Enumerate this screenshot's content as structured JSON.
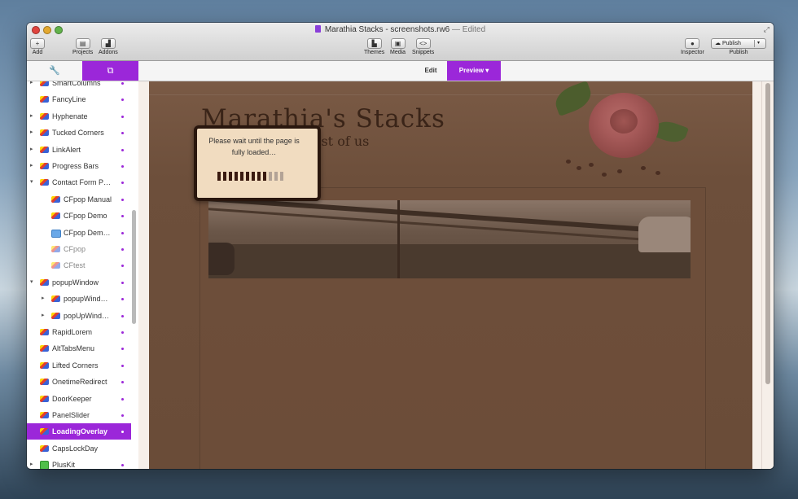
{
  "window": {
    "title": "Marathia Stacks - screenshots.rw6",
    "title_status": "— Edited"
  },
  "toolbar": {
    "add_label": "Add",
    "projects_label": "Projects",
    "addons_label": "Addons",
    "themes_label": "Themes",
    "media_label": "Media",
    "snippets_label": "Snippets",
    "inspector_label": "Inspector",
    "publish_button": "Publish",
    "publish_label": "Publish"
  },
  "modes": {
    "edit": "Edit",
    "preview": "Preview ▾"
  },
  "sidebar": {
    "items": [
      {
        "label": "SmartColumns",
        "arrow": "▸",
        "dot": true
      },
      {
        "label": "FancyLine",
        "arrow": "",
        "dot": true
      },
      {
        "label": "Hyphenate",
        "arrow": "▸",
        "dot": true
      },
      {
        "label": "Tucked Corners",
        "arrow": "▸",
        "dot": true
      },
      {
        "label": "LinkAlert",
        "arrow": "▸",
        "dot": true
      },
      {
        "label": "Progress Bars",
        "arrow": "▸",
        "dot": true
      },
      {
        "label": "Contact Form P…",
        "arrow": "▾",
        "dot": true
      },
      {
        "label": "CFpop Manual",
        "arrow": "",
        "dot": true
      },
      {
        "label": "CFpop Demo",
        "arrow": "",
        "dot": true
      },
      {
        "label": "CFpop Dem…",
        "arrow": "",
        "dot": true
      },
      {
        "label": "CFpop",
        "arrow": "",
        "dot": true
      },
      {
        "label": "CFtest",
        "arrow": "",
        "dot": true
      },
      {
        "label": "popupWindow",
        "arrow": "▾",
        "dot": true
      },
      {
        "label": "popupWind…",
        "arrow": "▸",
        "dot": true
      },
      {
        "label": "popUpWind…",
        "arrow": "▸",
        "dot": true
      },
      {
        "label": "RapidLorem",
        "arrow": "",
        "dot": true
      },
      {
        "label": "AltTabsMenu",
        "arrow": "",
        "dot": true
      },
      {
        "label": "Lifted Corners",
        "arrow": "",
        "dot": true
      },
      {
        "label": "OnetimeRedirect",
        "arrow": "",
        "dot": true
      },
      {
        "label": "DoorKeeper",
        "arrow": "",
        "dot": true
      },
      {
        "label": "PanelSlider",
        "arrow": "",
        "dot": true
      },
      {
        "label": "LoadingOverlay",
        "arrow": "",
        "dot": true
      },
      {
        "label": "CapsLockDay",
        "arrow": "",
        "dot": false
      },
      {
        "label": "PlusKit",
        "arrow": "▸",
        "dot": true
      }
    ]
  },
  "preview": {
    "site_title": "Marathia's Stacks",
    "site_subtitle": "est of us"
  },
  "overlay": {
    "message": "Please wait until the page is fully loaded…",
    "progress_filled": 9,
    "progress_total": 12
  },
  "colors": {
    "accent": "#9b27d9",
    "overlay_bg": "#f1dcc0",
    "overlay_border": "#2a170e",
    "progress_filled": "#3a1a10",
    "progress_empty": "#b3a396"
  }
}
